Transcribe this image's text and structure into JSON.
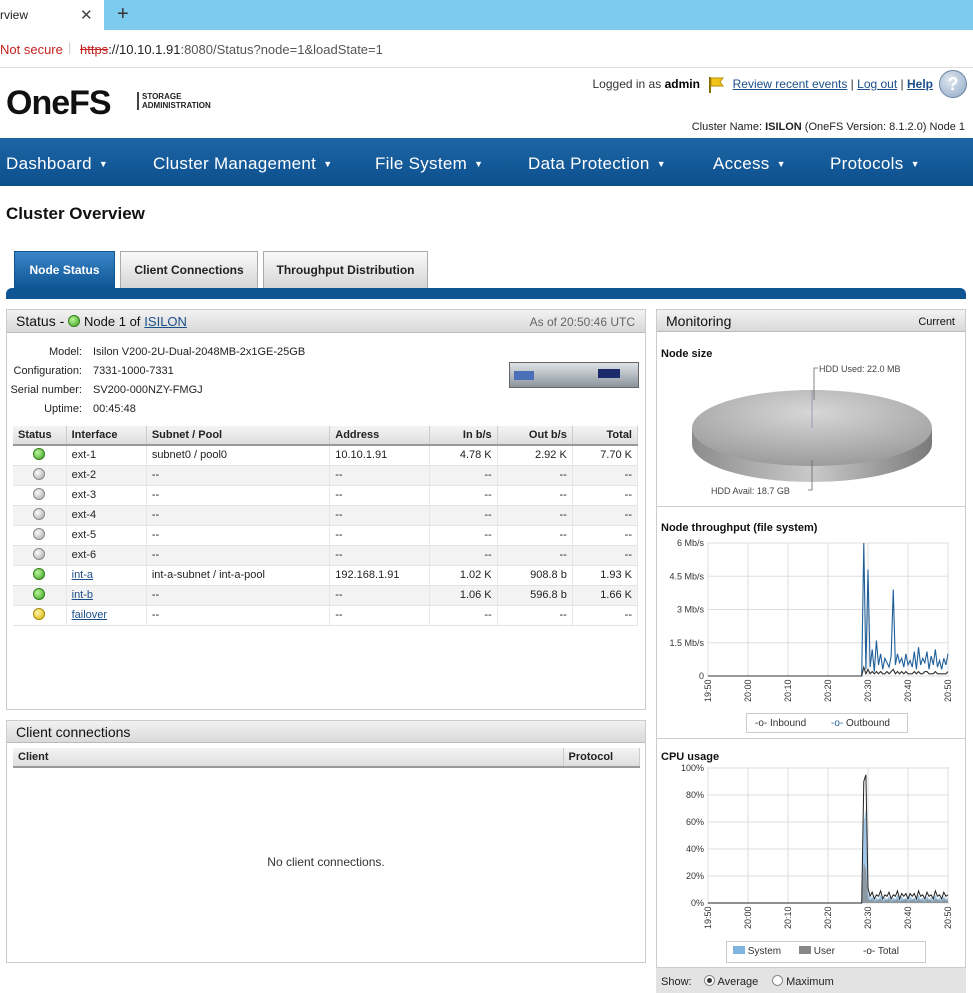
{
  "browser": {
    "tab_title": "rview",
    "close": "✕",
    "new_tab": "+",
    "not_secure": "Not secure",
    "url_proto": "https",
    "url_host": "://10.10.1.91",
    "url_rest": ":8080/Status?node=1&loadState=1"
  },
  "header": {
    "logo": "OneFS",
    "logo_sub_1": "STORAGE",
    "logo_sub_2": "ADMINISTRATION",
    "logged_in_prefix": "Logged in as",
    "user": "admin",
    "review_events": "Review recent events",
    "logout": "Log out",
    "help": "Help",
    "help_glyph": "?",
    "cluster_name_label": "Cluster Name:",
    "cluster_name": "ISILON",
    "cluster_version": "(OneFS Version: 8.1.2.0) Node 1"
  },
  "nav": {
    "items": [
      {
        "label": "Dashboard"
      },
      {
        "label": "Cluster Management"
      },
      {
        "label": "File System"
      },
      {
        "label": "Data Protection"
      },
      {
        "label": "Access"
      },
      {
        "label": "Protocols"
      }
    ],
    "caret": "▼"
  },
  "page": {
    "title": "Cluster Overview",
    "tabs": [
      {
        "label": "Node Status"
      },
      {
        "label": "Client Connections"
      },
      {
        "label": "Throughput Distribution"
      }
    ]
  },
  "status": {
    "title": "Status -",
    "node_text": "Node 1 of",
    "cluster_link": "ISILON",
    "as_of": "As of 20:50:46 UTC",
    "model_label": "Model:",
    "model": "Isilon V200-2U-Dual-2048MB-2x1GE-25GB",
    "config_label": "Configuration:",
    "config": "7331-1000-7331",
    "serial_label": "Serial number:",
    "serial": "SV200-000NZY-FMGJ",
    "uptime_label": "Uptime:",
    "uptime": "00:45:48"
  },
  "interfaces": {
    "headers": [
      "Status",
      "Interface",
      "Subnet / Pool",
      "Address",
      "In b/s",
      "Out b/s",
      "Total"
    ],
    "rows": [
      {
        "status": "green",
        "iface": "ext-1",
        "link": false,
        "subnet": "subnet0 / pool0",
        "address": "10.10.1.91",
        "in": "4.78 K",
        "out": "2.92 K",
        "total": "7.70 K"
      },
      {
        "status": "gray",
        "iface": "ext-2",
        "link": false,
        "subnet": "--",
        "address": "--",
        "in": "--",
        "out": "--",
        "total": "--"
      },
      {
        "status": "gray",
        "iface": "ext-3",
        "link": false,
        "subnet": "--",
        "address": "--",
        "in": "--",
        "out": "--",
        "total": "--"
      },
      {
        "status": "gray",
        "iface": "ext-4",
        "link": false,
        "subnet": "--",
        "address": "--",
        "in": "--",
        "out": "--",
        "total": "--"
      },
      {
        "status": "gray",
        "iface": "ext-5",
        "link": false,
        "subnet": "--",
        "address": "--",
        "in": "--",
        "out": "--",
        "total": "--"
      },
      {
        "status": "gray",
        "iface": "ext-6",
        "link": false,
        "subnet": "--",
        "address": "--",
        "in": "--",
        "out": "--",
        "total": "--"
      },
      {
        "status": "green",
        "iface": "int-a",
        "link": true,
        "subnet": "int-a-subnet / int-a-pool",
        "address": "192.168.1.91",
        "in": "1.02 K",
        "out": "908.8 b",
        "total": "1.93 K"
      },
      {
        "status": "green",
        "iface": "int-b",
        "link": true,
        "subnet": "--",
        "address": "--",
        "in": "1.06 K",
        "out": "596.8 b",
        "total": "1.66 K"
      },
      {
        "status": "yellow",
        "iface": "failover",
        "link": true,
        "subnet": "--",
        "address": "--",
        "in": "--",
        "out": "--",
        "total": "--"
      }
    ]
  },
  "clients": {
    "title": "Client connections",
    "headers": [
      "Client",
      "Protocol"
    ],
    "empty": "No client connections."
  },
  "monitoring": {
    "title": "Monitoring",
    "mode": "Current",
    "node_size_title": "Node size",
    "hdd_used": "HDD Used: 22.0 MB",
    "hdd_avail": "HDD Avail: 18.7 GB",
    "throughput_title": "Node throughput (file system)",
    "cpu_title": "CPU usage",
    "legend_inbound": "Inbound",
    "legend_outbound": "Outbound",
    "legend_system": "System",
    "legend_user": "User",
    "legend_total": "Total",
    "show_label": "Show:",
    "show_average": "Average",
    "show_maximum": "Maximum",
    "colors": {
      "outbound": "#1f5f99",
      "inbound": "#333333",
      "system": "#7fb3e0",
      "user": "#888888"
    }
  },
  "chart_data": [
    {
      "type": "pie",
      "title": "Node size",
      "categories": [
        "HDD Used",
        "HDD Avail"
      ],
      "values": [
        0.022,
        18.7
      ],
      "unit": "GB"
    },
    {
      "type": "line",
      "title": "Node throughput (file system)",
      "x": [
        "19:50",
        "20:00",
        "20:10",
        "20:20",
        "20:30",
        "20:40",
        "20:50"
      ],
      "yticks": [
        "0",
        "1.5 Mb/s",
        "3 Mb/s",
        "4.5 Mb/s",
        "6 Mb/s"
      ],
      "ylim": [
        0,
        6
      ],
      "ylabel": "Mb/s",
      "series": [
        {
          "name": "Outbound",
          "values": [
            0,
            0,
            0,
            0,
            0,
            0,
            0,
            0,
            0,
            0,
            0,
            0,
            0,
            0,
            0,
            0,
            0,
            0,
            0,
            0,
            0,
            0,
            0,
            0,
            0,
            0,
            0,
            0,
            0,
            0,
            0,
            0,
            0,
            0,
            0,
            0,
            0,
            0,
            0,
            0,
            0,
            0,
            0,
            0,
            0,
            0,
            0,
            0,
            0,
            0,
            0,
            0,
            0,
            0,
            0,
            0,
            0,
            0,
            0,
            0,
            0,
            0,
            0,
            0,
            0,
            0,
            0,
            0,
            0,
            0,
            0,
            0,
            0,
            0,
            6.0,
            0.3,
            4.8,
            0.4,
            1.2,
            0.2,
            1.6,
            0.5,
            1.0,
            0.3,
            0.8,
            0.6,
            0.4,
            0.9,
            3.9,
            0.5,
            1.0,
            0.6,
            0.8,
            0.4,
            1.0,
            0.5,
            0.7,
            0.4,
            1.1,
            0.3,
            1.3,
            0.5,
            0.8,
            0.6,
            1.1,
            0.3,
            0.9,
            0.5,
            1.2,
            0.4,
            0.7,
            0.3,
            0.8,
            0.5,
            1.0
          ]
        },
        {
          "name": "Inbound",
          "values": [
            0,
            0,
            0,
            0,
            0,
            0,
            0,
            0,
            0,
            0,
            0,
            0,
            0,
            0,
            0,
            0,
            0,
            0,
            0,
            0,
            0,
            0,
            0,
            0,
            0,
            0,
            0,
            0,
            0,
            0,
            0,
            0,
            0,
            0,
            0,
            0,
            0,
            0,
            0,
            0,
            0,
            0,
            0,
            0,
            0,
            0,
            0,
            0,
            0,
            0,
            0,
            0,
            0,
            0,
            0,
            0,
            0,
            0,
            0,
            0,
            0,
            0,
            0,
            0,
            0,
            0,
            0,
            0,
            0,
            0,
            0,
            0,
            0,
            0,
            0.4,
            0.1,
            0.3,
            0.1,
            0.2,
            0.1,
            0.2,
            0.1,
            0.2,
            0.1,
            0.1,
            0.2,
            0.1,
            0.2,
            0.3,
            0.1,
            0.2,
            0.1,
            0.2,
            0.1,
            0.2,
            0.1,
            0.1,
            0.1,
            0.2,
            0.1,
            0.2,
            0.1,
            0.1,
            0.2,
            0.2,
            0.1,
            0.1,
            0.1,
            0.2,
            0.1,
            0.1,
            0.1,
            0.1,
            0.1,
            0.2
          ]
        }
      ]
    },
    {
      "type": "area",
      "title": "CPU usage",
      "x": [
        "19:50",
        "20:00",
        "20:10",
        "20:20",
        "20:30",
        "20:40",
        "20:50"
      ],
      "yticks": [
        "0%",
        "20%",
        "40%",
        "60%",
        "80%",
        "100%"
      ],
      "ylim": [
        0,
        100
      ],
      "series": [
        {
          "name": "System",
          "values": [
            0,
            0,
            0,
            0,
            0,
            0,
            0,
            0,
            0,
            0,
            0,
            0,
            0,
            0,
            0,
            0,
            0,
            0,
            0,
            0,
            0,
            0,
            0,
            0,
            0,
            0,
            0,
            0,
            0,
            0,
            0,
            0,
            0,
            0,
            0,
            0,
            0,
            0,
            0,
            0,
            0,
            0,
            0,
            0,
            0,
            0,
            0,
            0,
            0,
            0,
            0,
            0,
            0,
            0,
            0,
            0,
            0,
            0,
            0,
            0,
            0,
            0,
            0,
            0,
            0,
            0,
            0,
            0,
            0,
            0,
            0,
            0,
            0,
            0,
            60,
            70,
            8,
            3,
            5,
            2,
            4,
            3,
            6,
            2,
            4,
            3,
            5,
            2,
            4,
            3,
            6,
            2,
            5,
            3,
            4,
            2,
            5,
            3,
            4,
            2,
            6,
            3,
            4,
            2,
            5,
            3,
            4,
            2,
            6,
            3,
            4,
            2,
            5,
            3,
            4
          ]
        },
        {
          "name": "User",
          "values": [
            0,
            0,
            0,
            0,
            0,
            0,
            0,
            0,
            0,
            0,
            0,
            0,
            0,
            0,
            0,
            0,
            0,
            0,
            0,
            0,
            0,
            0,
            0,
            0,
            0,
            0,
            0,
            0,
            0,
            0,
            0,
            0,
            0,
            0,
            0,
            0,
            0,
            0,
            0,
            0,
            0,
            0,
            0,
            0,
            0,
            0,
            0,
            0,
            0,
            0,
            0,
            0,
            0,
            0,
            0,
            0,
            0,
            0,
            0,
            0,
            0,
            0,
            0,
            0,
            0,
            0,
            0,
            0,
            0,
            0,
            0,
            0,
            0,
            0,
            30,
            25,
            3,
            2,
            3,
            1,
            2,
            2,
            3,
            1,
            2,
            2,
            3,
            1,
            2,
            2,
            3,
            1,
            2,
            2,
            3,
            1,
            2,
            2,
            3,
            1,
            3,
            2,
            2,
            1,
            3,
            2,
            2,
            1,
            3,
            2,
            2,
            1,
            3,
            2,
            2
          ]
        },
        {
          "name": "Total",
          "values": [
            0,
            0,
            0,
            0,
            0,
            0,
            0,
            0,
            0,
            0,
            0,
            0,
            0,
            0,
            0,
            0,
            0,
            0,
            0,
            0,
            0,
            0,
            0,
            0,
            0,
            0,
            0,
            0,
            0,
            0,
            0,
            0,
            0,
            0,
            0,
            0,
            0,
            0,
            0,
            0,
            0,
            0,
            0,
            0,
            0,
            0,
            0,
            0,
            0,
            0,
            0,
            0,
            0,
            0,
            0,
            0,
            0,
            0,
            0,
            0,
            0,
            0,
            0,
            0,
            0,
            0,
            0,
            0,
            0,
            0,
            0,
            0,
            0,
            0,
            90,
            95,
            11,
            5,
            8,
            3,
            6,
            5,
            9,
            3,
            6,
            5,
            8,
            3,
            6,
            5,
            9,
            3,
            7,
            5,
            7,
            3,
            7,
            5,
            7,
            3,
            9,
            5,
            6,
            3,
            8,
            5,
            6,
            3,
            9,
            5,
            6,
            3,
            8,
            5,
            6
          ]
        }
      ]
    }
  ]
}
